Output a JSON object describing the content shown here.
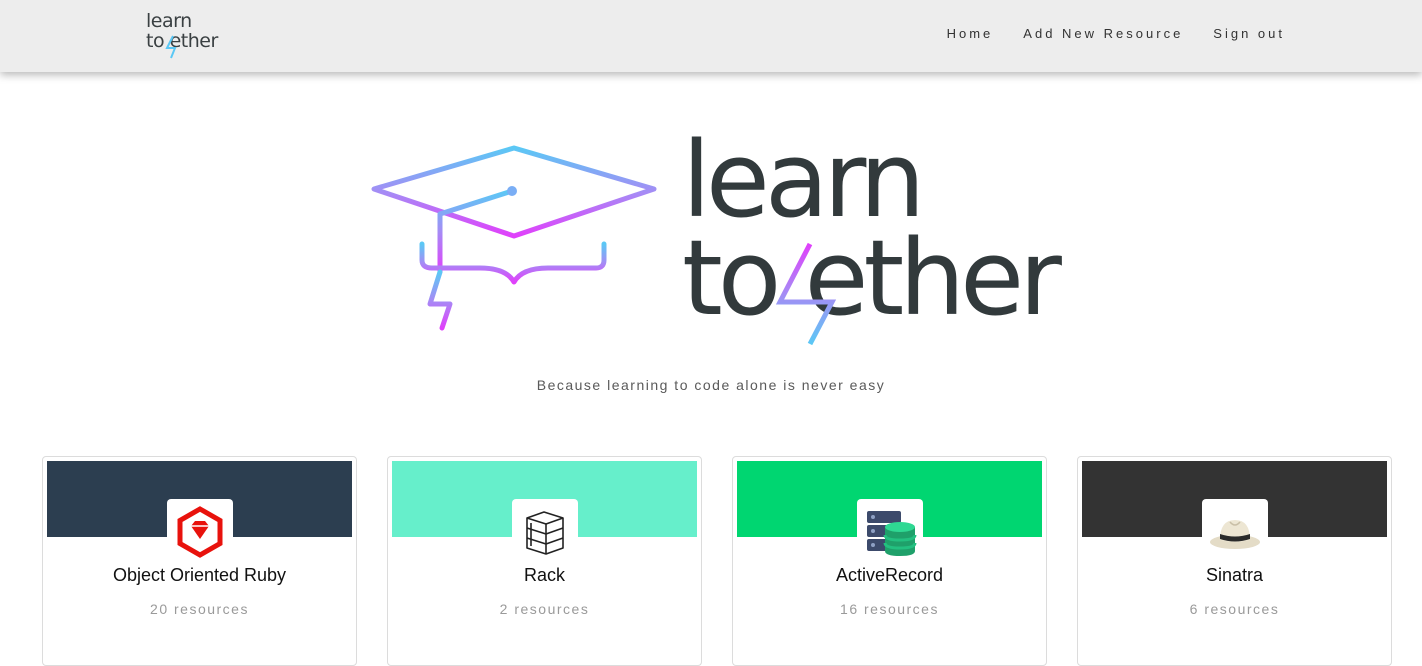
{
  "navbar": {
    "brand": {
      "line1": "learn",
      "line2": "to ether"
    },
    "links": [
      "Home",
      "Add New Resource",
      "Sign out"
    ]
  },
  "hero": {
    "word1": "learn",
    "word2": "to   ether",
    "tagline": "Because learning to code alone is never easy"
  },
  "colors": {
    "gradient_start": "#5bc8f5",
    "gradient_mid": "#a58cf5",
    "gradient_end": "#e040fb"
  },
  "cards": [
    {
      "title": "Object Oriented Ruby",
      "count": "20 resources",
      "banner": "#2c3e50",
      "icon": "ruby-gem-icon"
    },
    {
      "title": "Rack",
      "count": "2 resources",
      "banner": "#66efcb",
      "icon": "rack-icon"
    },
    {
      "title": "ActiveRecord",
      "count": "16 resources",
      "banner": "#00d671",
      "icon": "database-icon"
    },
    {
      "title": "Sinatra",
      "count": "6 resources",
      "banner": "#333333",
      "icon": "fedora-hat-icon"
    }
  ]
}
